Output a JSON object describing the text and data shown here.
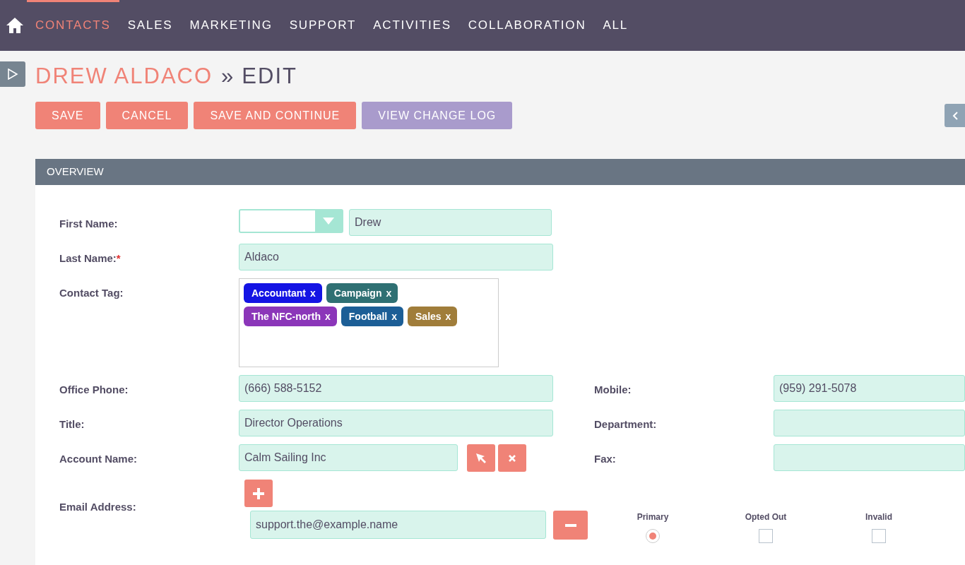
{
  "nav": {
    "items": [
      {
        "label": "CONTACTS",
        "selected": true
      },
      {
        "label": "SALES",
        "selected": false
      },
      {
        "label": "MARKETING",
        "selected": false
      },
      {
        "label": "SUPPORT",
        "selected": false
      },
      {
        "label": "ACTIVITIES",
        "selected": false
      },
      {
        "label": "COLLABORATION",
        "selected": false
      },
      {
        "label": "ALL",
        "selected": false
      }
    ]
  },
  "title": {
    "record": "DREW ALDACO",
    "separator": "»",
    "action": "EDIT"
  },
  "buttons": [
    {
      "label": "SAVE",
      "kind": "primary"
    },
    {
      "label": "CANCEL",
      "kind": "primary"
    },
    {
      "label": "SAVE AND CONTINUE",
      "kind": "primary"
    },
    {
      "label": "VIEW CHANGE LOG",
      "kind": "secondary"
    }
  ],
  "panel": {
    "title": "OVERVIEW"
  },
  "rows": [
    {
      "left": {
        "kind": "name",
        "label": "First Name:",
        "value": "Drew",
        "required": false
      }
    },
    {
      "left": {
        "kind": "text",
        "label": "Last Name:",
        "value": "Aldaco",
        "required": true,
        "required_mark": "*"
      }
    },
    {
      "left": {
        "kind": "tags",
        "label": "Contact Tag:",
        "required": false,
        "tags": [
          {
            "label": "Accountant",
            "remove": "x",
            "color": "#1414e4"
          },
          {
            "label": "Campaign",
            "remove": "x",
            "color": "#2f7073"
          },
          {
            "label": "The NFC-north",
            "remove": "x",
            "color": "#8b36b9"
          },
          {
            "label": "Football",
            "remove": "x",
            "color": "#1c5e96"
          },
          {
            "label": "Sales",
            "remove": "x",
            "color": "#a07d3a"
          }
        ]
      }
    }
  ],
  "pair_rows": [
    {
      "left": {
        "kind": "text",
        "label": "Office Phone:",
        "value": "(666) 588-5152"
      },
      "right": {
        "label": "Mobile:",
        "value": "(959) 291-5078"
      }
    },
    {
      "left": {
        "kind": "text",
        "label": "Title:",
        "value": "Director Operations"
      },
      "right": {
        "label": "Department:"
      }
    },
    {
      "left": {
        "kind": "relate",
        "label": "Account Name:",
        "value": "Calm Sailing Inc"
      },
      "right": {
        "label": "Fax:"
      }
    }
  ],
  "email": {
    "label": "Email Address:",
    "columns": [
      "Primary",
      "Opted Out",
      "Invalid"
    ],
    "addresses": [
      {
        "value": "support.the@example.name",
        "primary": true,
        "opted_out": false,
        "invalid": false
      }
    ]
  }
}
